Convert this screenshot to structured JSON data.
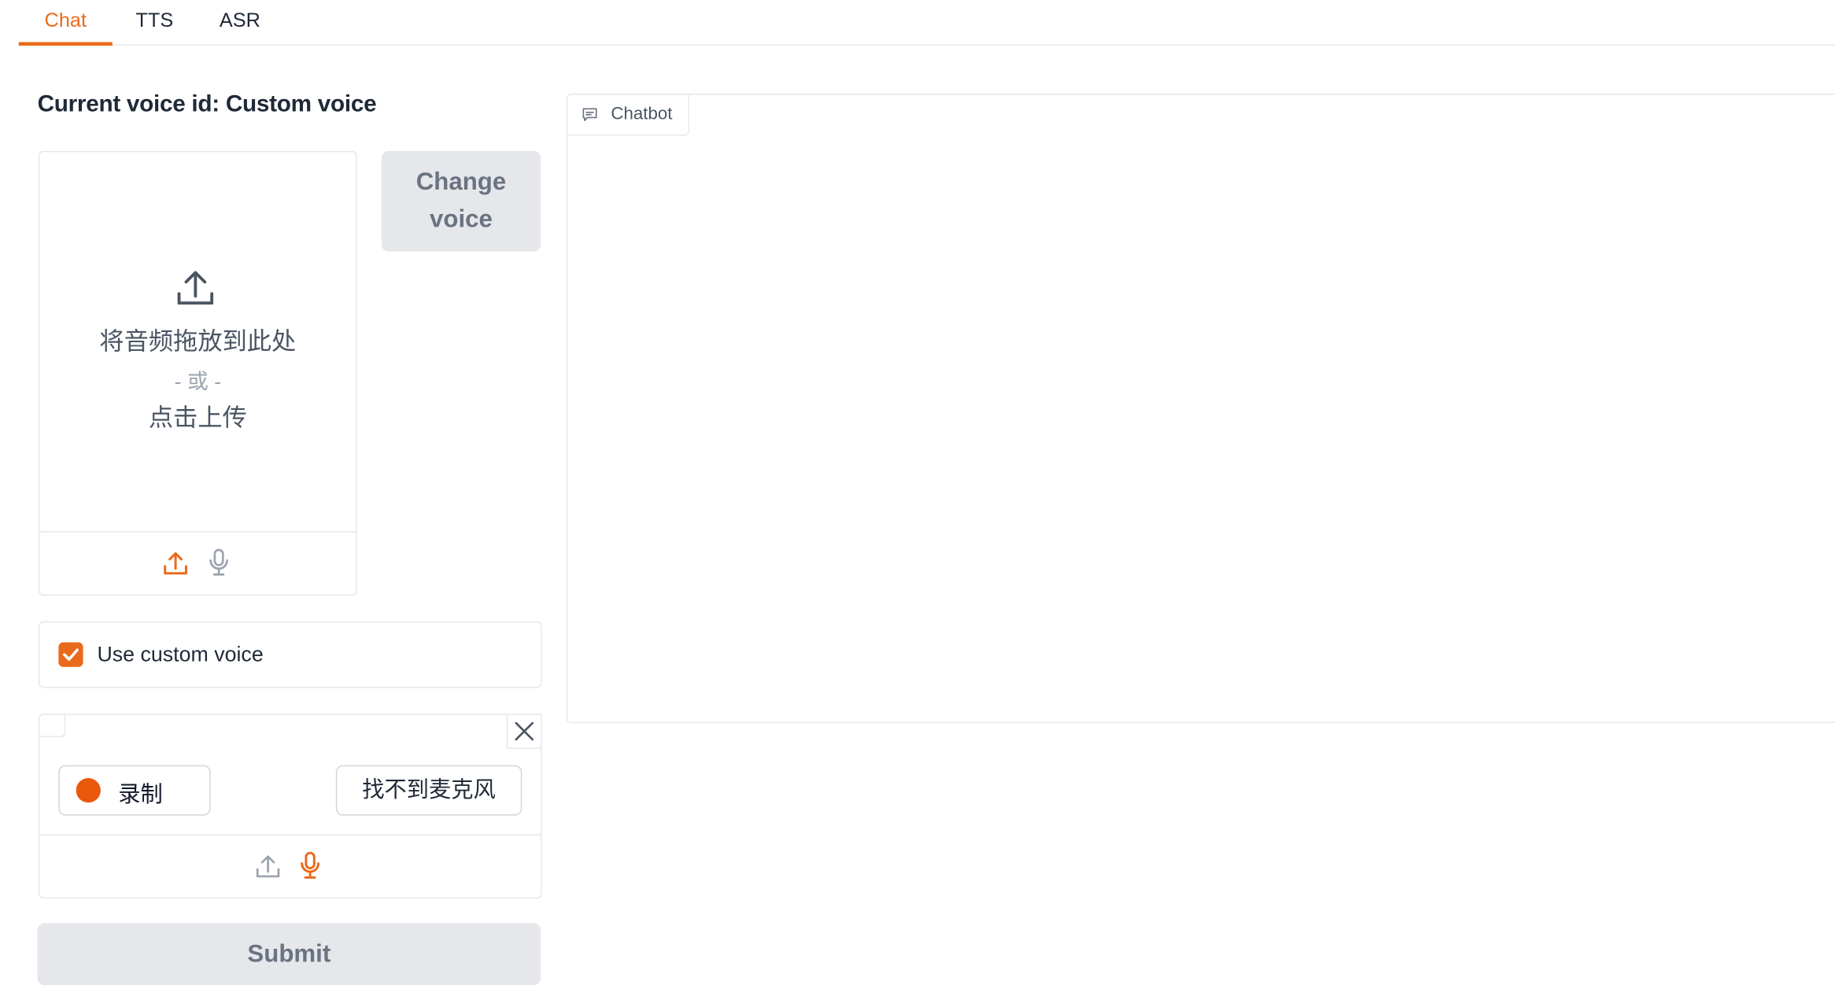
{
  "tabs": [
    {
      "label": "Chat",
      "active": true
    },
    {
      "label": "TTS",
      "active": false
    },
    {
      "label": "ASR",
      "active": false
    }
  ],
  "voice_title": "Current voice id: Custom voice",
  "upload": {
    "drop_text": "将音频拖放到此处",
    "or_text": "- 或 -",
    "click_text": "点击上传",
    "icons": [
      "upload-icon",
      "microphone-icon"
    ]
  },
  "change_voice": {
    "line1": "Change",
    "line2": "voice"
  },
  "custom_voice_checkbox": {
    "label": "Use custom voice",
    "checked": true
  },
  "recorder": {
    "record_label": "录制",
    "no_mic_label": "找不到麦克风",
    "icons": [
      "upload-icon",
      "microphone-icon",
      "close-icon"
    ]
  },
  "submit_label": "Submit",
  "chatbot": {
    "label": "Chatbot",
    "icon": "chat-bubble-icon"
  },
  "colors": {
    "accent": "#ea6a1b",
    "record_dot": "#ea580c",
    "button_gray": "#e5e7eb",
    "border": "#e5e7eb"
  }
}
